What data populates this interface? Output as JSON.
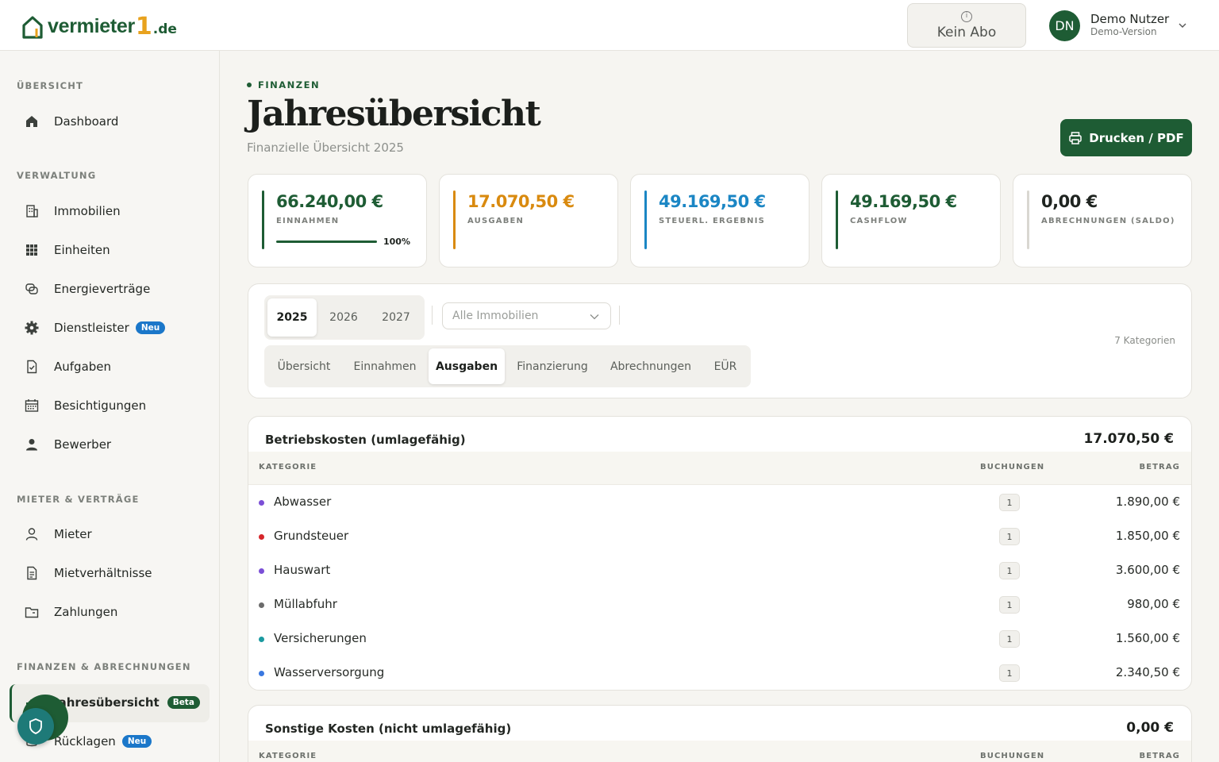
{
  "header": {
    "logo_main": "vermieter",
    "logo_one": "1",
    "logo_tld": ".de",
    "abo_label": "Kein Abo",
    "user_initials": "DN",
    "user_name": "Demo Nutzer",
    "user_sub": "Demo-Version"
  },
  "sidebar": {
    "sections": [
      {
        "title": "ÜBERSICHT"
      },
      {
        "title": "VERWALTUNG"
      },
      {
        "title": "MIETER & VERTRÄGE"
      },
      {
        "title": "FINANZEN & ABRECHNUNGEN"
      }
    ],
    "items": [
      {
        "label": "Dashboard",
        "icon": "home-icon"
      },
      {
        "label": "Immobilien",
        "icon": "building-icon"
      },
      {
        "label": "Einheiten",
        "icon": "grid-icon"
      },
      {
        "label": "Energieverträge",
        "icon": "energy-icon"
      },
      {
        "label": "Dienstleister",
        "icon": "gear-icon",
        "badge": "Neu"
      },
      {
        "label": "Aufgaben",
        "icon": "task-icon"
      },
      {
        "label": "Besichtigungen",
        "icon": "calendar-icon"
      },
      {
        "label": "Bewerber",
        "icon": "person-icon"
      },
      {
        "label": "Mieter",
        "icon": "user-outline-icon"
      },
      {
        "label": "Mietverhältnisse",
        "icon": "document-icon"
      },
      {
        "label": "Zahlungen",
        "icon": "folder-icon"
      },
      {
        "label": "Jahresübersicht",
        "icon": "chart-icon",
        "badge": "Beta"
      },
      {
        "label": "Rücklagen",
        "icon": "coins-icon",
        "badge": "Neu"
      }
    ]
  },
  "main": {
    "eyebrow": "FINANZEN",
    "title": "Jahresübersicht",
    "subtitle": "Finanzielle Übersicht 2025",
    "print_label": "Drucken / PDF"
  },
  "kpis": [
    {
      "value": "66.240,00 €",
      "label": "EINNAHMEN",
      "color": "#1e5c34",
      "progress": "100%"
    },
    {
      "value": "17.070,50 €",
      "label": "AUSGABEN",
      "color": "#d98a0f"
    },
    {
      "value": "49.169,50 €",
      "label": "STEUERL. ERGEBNIS",
      "color": "#1b86c4"
    },
    {
      "value": "49.169,50 €",
      "label": "CASHFLOW",
      "color": "#1e5c34"
    },
    {
      "value": "0,00 €",
      "label": "ABRECHNUNGEN (SALDO)",
      "color": "#1f2420"
    }
  ],
  "filters": {
    "years": [
      "2025",
      "2026",
      "2027"
    ],
    "active_year": "2025",
    "property_placeholder": "Alle Immobilien",
    "category_count": "7 Kategorien",
    "tabs": [
      "Übersicht",
      "Einnahmen",
      "Ausgaben",
      "Finanzierung",
      "Abrechnungen",
      "EÜR"
    ],
    "active_tab": "Ausgaben"
  },
  "tables": [
    {
      "title": "Betriebskosten (umlagefähig)",
      "total": "17.070,50 €",
      "columns": [
        "KATEGORIE",
        "BUCHUNGEN",
        "BETRAG"
      ],
      "rows": [
        {
          "name": "Abwasser",
          "count": "1",
          "amount": "1.890,00 €",
          "color": "#7b4fd6"
        },
        {
          "name": "Grundsteuer",
          "count": "1",
          "amount": "1.850,00 €",
          "color": "#d6262b"
        },
        {
          "name": "Hauswart",
          "count": "1",
          "amount": "3.600,00 €",
          "color": "#7b4fd6"
        },
        {
          "name": "Müllabfuhr",
          "count": "1",
          "amount": "980,00 €",
          "color": "#6b6b6b"
        },
        {
          "name": "Versicherungen",
          "count": "1",
          "amount": "1.560,00 €",
          "color": "#1b9aa0"
        },
        {
          "name": "Wasserversorgung",
          "count": "1",
          "amount": "2.340,50 €",
          "color": "#3a78e0"
        }
      ]
    },
    {
      "title": "Sonstige Kosten (nicht umlagefähig)",
      "total": "0,00 €",
      "columns": [
        "KATEGORIE",
        "BUCHUNGEN",
        "BETRAG"
      ],
      "rows": []
    }
  ]
}
